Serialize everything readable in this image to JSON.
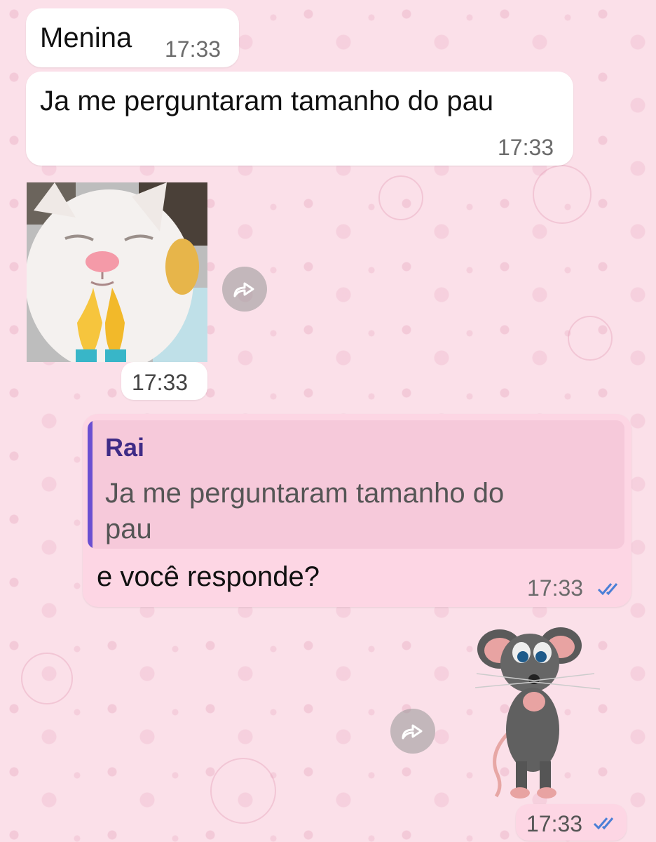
{
  "messages": [
    {
      "text": "Menina",
      "time": "17:33"
    },
    {
      "text": "Ja me perguntaram tamanho do pau",
      "time": "17:33"
    },
    {
      "image": "cat-praying-sticker",
      "time": "17:33"
    },
    {
      "reply": {
        "author": "Rai",
        "quoted_line1": "Ja me perguntaram tamanho do",
        "quoted_line2": "pau"
      },
      "text": "e você responde?",
      "time": "17:33"
    },
    {
      "image": "mouse-sticker",
      "time": "17:33"
    }
  ],
  "icons": {
    "forward": "forward-icon",
    "read_ticks": "double-check-icon"
  },
  "colors": {
    "background": "#fbe0e9",
    "incoming_bubble": "#ffffff",
    "outgoing_bubble": "#fdd6e4",
    "quote_bar": "#6a4fd1",
    "read_ticks": "#4a7fd6"
  }
}
